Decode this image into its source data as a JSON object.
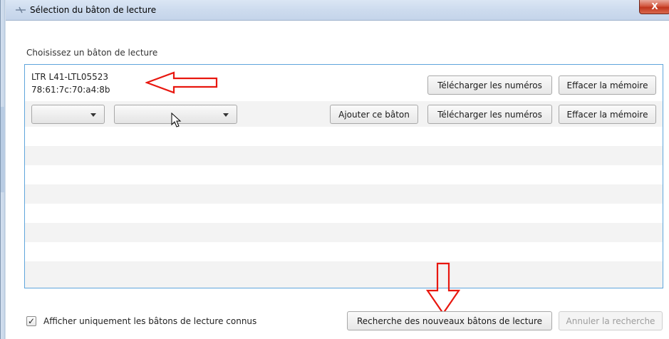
{
  "window": {
    "title": "Sélection du bâton de lecture",
    "close_glyph": "X"
  },
  "main": {
    "section_label": "Choisissez un bâton de lecture"
  },
  "device_list": {
    "known_device": {
      "name": "LTR L41-LTL05523",
      "mac": "78:61:7c:70:a4:8b",
      "download_label": "Télécharger les numéros",
      "clear_label": "Effacer la mémoire"
    },
    "new_device": {
      "combo_1_value": "",
      "combo_2_value": "",
      "add_label": "Ajouter ce bâton",
      "download_label": "Télécharger les numéros",
      "clear_label": "Effacer la mémoire"
    }
  },
  "footer": {
    "checkbox_label": "Afficher uniquement les bâtons de lecture connus",
    "checkbox_checked": true,
    "checkbox_glyph": "✓",
    "search_label": "Recherche des nouveaux bâtons de lecture",
    "cancel_search_label": "Annuler la recherche"
  },
  "annotations": {
    "arrow_color": "#e8170f"
  },
  "colors": {
    "list_border": "#5fa5dc",
    "row_stripe": "#f3f3f3"
  }
}
